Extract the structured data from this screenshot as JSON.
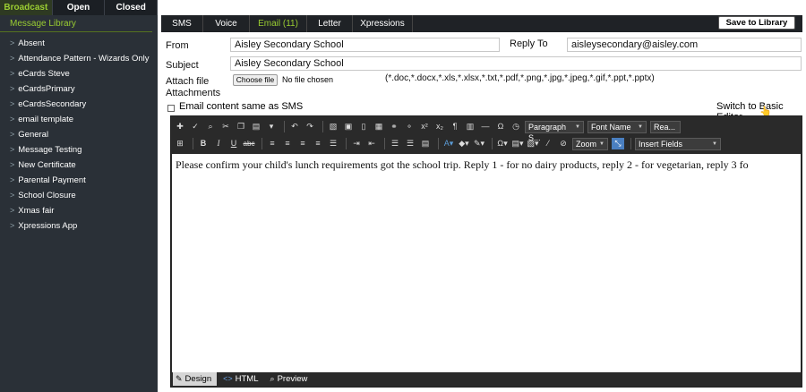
{
  "sidebar": {
    "tabs": [
      {
        "label": "Broadcast",
        "active": true
      },
      {
        "label": "Open",
        "active": false
      },
      {
        "label": "Closed",
        "active": false
      }
    ],
    "library_title": "Message Library",
    "items": [
      "Absent",
      "Attendance Pattern - Wizards Only",
      "eCards Steve",
      "eCardsPrimary",
      "eCardsSecondary",
      "email template",
      "General",
      "Message Testing",
      "New Certificate",
      "Parental Payment",
      "School Closure",
      "Xmas fair",
      "Xpressions App"
    ]
  },
  "tabs": {
    "sms": "SMS",
    "voice": "Voice",
    "email": "Email (11)",
    "letter": "Letter",
    "xpressions": "Xpressions",
    "active": "email"
  },
  "save_button": "Save to Library",
  "form": {
    "from_label": "From",
    "from_value": "Aisley Secondary School",
    "reply_to_label": "Reply To",
    "reply_to_value": "aisleysecondary@aisley.com",
    "subject_label": "Subject",
    "subject_value": "Aisley Secondary School",
    "attach_label_1": "Attach file",
    "attach_label_2": "Attachments",
    "choose_file": "Choose file",
    "no_file": "No file chosen",
    "allowed_types": "(*.doc,*.docx,*.xls,*.xlsx,*.txt,*.pdf,*.png,*.jpg,*.jpeg,*.gif,*.ppt,*.pptx)",
    "sms_same_label": "Email content same as SMS",
    "sms_same_checked": false,
    "switch_editor": "Switch to Basic Editor"
  },
  "editor": {
    "toolbar_selects": {
      "paragraph": "Paragraph S...",
      "font": "Font Name",
      "size": "Rea...",
      "zoom": "Zoom",
      "insert": "Insert Fields"
    },
    "content": "Please confirm your child's lunch requirements got the school trip. Reply 1 - for no dairy products, reply 2 - for vegetarian, reply 3 fo",
    "modes": [
      {
        "label": "Design",
        "icon": "pencil-icon",
        "active": true
      },
      {
        "label": "HTML",
        "icon": "code-icon",
        "active": false
      },
      {
        "label": "Preview",
        "icon": "magnifier-icon",
        "active": false
      }
    ]
  },
  "colors": {
    "sidebar_bg": "#2a3037",
    "accent_green": "#9acd32",
    "toolbar_bg": "#2a2a2a"
  }
}
